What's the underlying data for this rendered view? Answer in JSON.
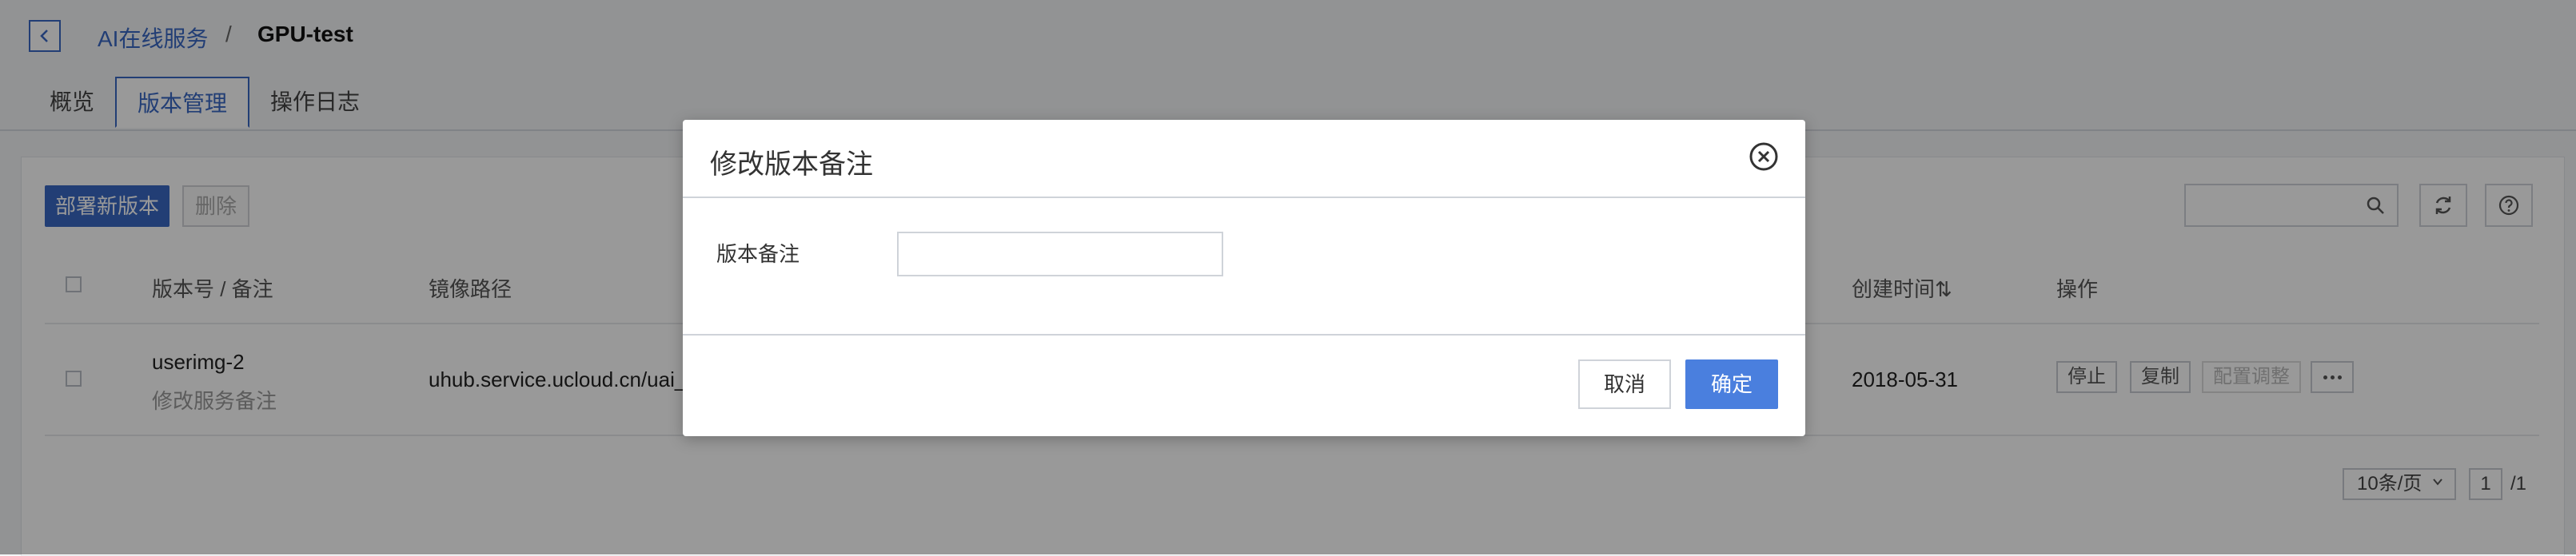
{
  "breadcrumb": {
    "parent": "AI在线服务",
    "separator": "/",
    "current": "GPU-test"
  },
  "tabs": [
    {
      "label": "概览"
    },
    {
      "label": "版本管理"
    },
    {
      "label": "操作日志"
    }
  ],
  "toolbar": {
    "deploy_label": "部署新版本",
    "delete_label": "删除",
    "search_placeholder": ""
  },
  "table": {
    "headers": {
      "version": "版本号 / 备注",
      "image": "镜像路径",
      "created": "创建时间⇅",
      "ops": "操作"
    },
    "rows": [
      {
        "version": "userimg-2",
        "remark": "修改服务备注",
        "image": "uhub.service.ucloud.cn/uai_d",
        "created": "2018-05-31",
        "ops": {
          "stop": "停止",
          "copy": "复制",
          "config": "配置调整"
        }
      }
    ]
  },
  "pagination": {
    "page_size": "10条/页",
    "current": "1",
    "total": "/1"
  },
  "modal": {
    "title": "修改版本备注",
    "field_label": "版本备注",
    "field_value": "",
    "cancel_label": "取消",
    "ok_label": "确定"
  },
  "colors": {
    "accent": "#3a68c4",
    "primary_button": "#4a7fde",
    "overlay": "rgba(0,0,0,0.4)"
  }
}
